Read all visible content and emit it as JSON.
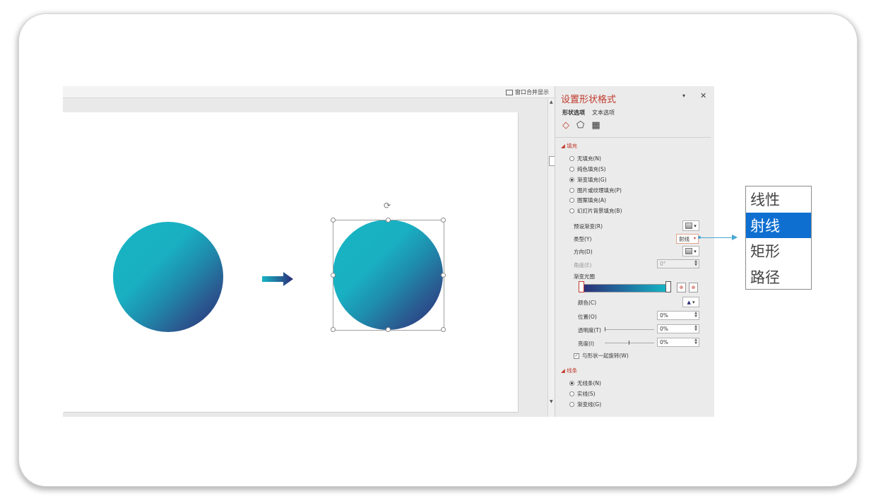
{
  "window": {
    "merge_label": "窗口合并显示"
  },
  "format_pane": {
    "title": "设置形状格式",
    "minimize": "▾",
    "close": "✕",
    "tabs": [
      "形状选项",
      "文本选项"
    ],
    "icons": [
      "fill-line-icon",
      "effects-pentagon-icon",
      "size-properties-icon"
    ],
    "fill": {
      "header": "填充",
      "options": [
        "无填充(N)",
        "纯色填充(S)",
        "渐变填充(G)",
        "图片或纹理填充(P)",
        "图案填充(A)",
        "幻灯片背景填充(B)"
      ],
      "selected_index": 2,
      "preset_label": "预设渐变(R)",
      "type_label": "类型(Y)",
      "type_value": "射线",
      "direction_label": "方向(D)",
      "angle_label": "角度(E)",
      "angle_value": "0°",
      "stops_label": "渐变光圈",
      "color_label": "颜色(C)",
      "position_label": "位置(O)",
      "position_value": "0%",
      "transparency_label": "透明度(T)",
      "transparency_value": "0%",
      "brightness_label": "亮度(I)",
      "brightness_value": "0%",
      "rotate_label": "与形状一起旋转(W)",
      "rotate_checked": true
    },
    "line": {
      "header": "线条",
      "options": [
        "无线条(N)",
        "实线(S)",
        "渐变线(G)"
      ],
      "selected_index": 0
    }
  },
  "type_dropdown": {
    "items": [
      "线性",
      "射线",
      "矩形",
      "路径"
    ],
    "selected_index": 1
  },
  "colors": {
    "accent": "#c0392b",
    "gradient_start": "#17b5c4",
    "gradient_end": "#2c2c78",
    "dropdown_selected": "#0e6fd1",
    "connector": "#49a6cf"
  }
}
